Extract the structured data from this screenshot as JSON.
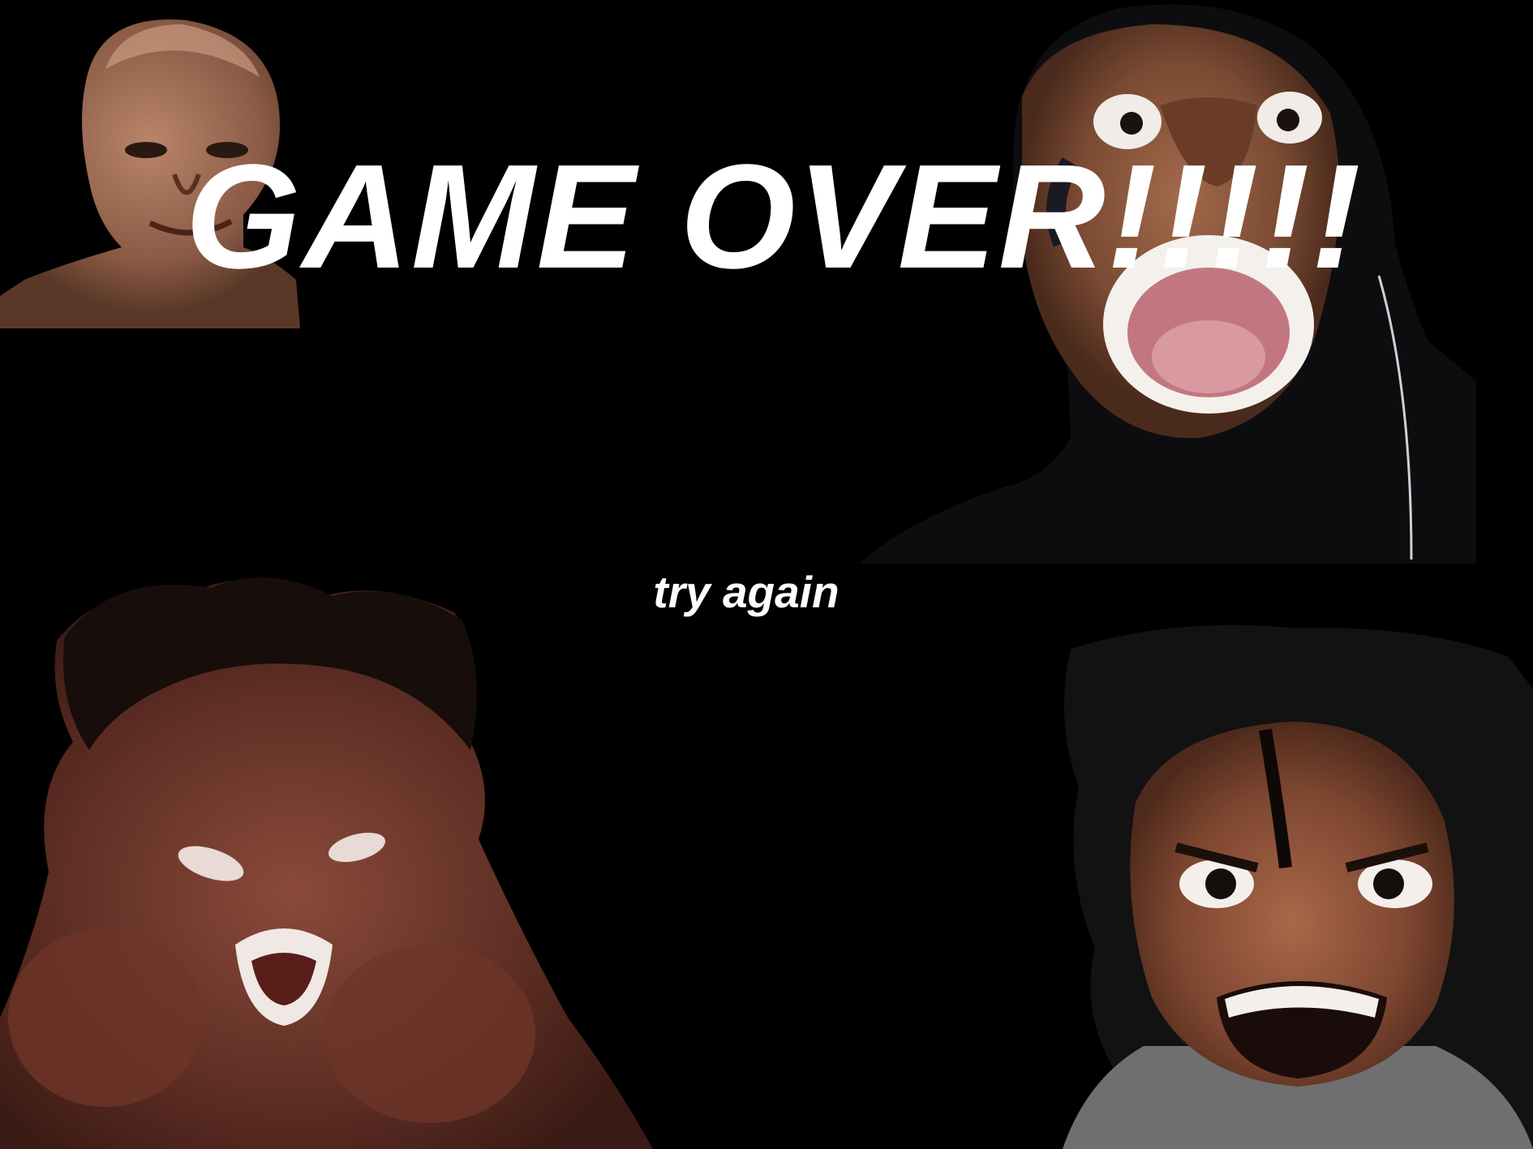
{
  "screen": {
    "title": "GAME OVER!!!!!",
    "retry_label": "try again",
    "background_color": "#000000",
    "text_color": "#ffffff"
  },
  "photos": [
    {
      "name": "bald-face-photo",
      "description_icon": "face-photo"
    },
    {
      "name": "screaming-face-photo",
      "description_icon": "face-photo"
    },
    {
      "name": "flexing-face-photo",
      "description_icon": "face-photo"
    },
    {
      "name": "grimacing-face-photo",
      "description_icon": "face-photo"
    }
  ]
}
